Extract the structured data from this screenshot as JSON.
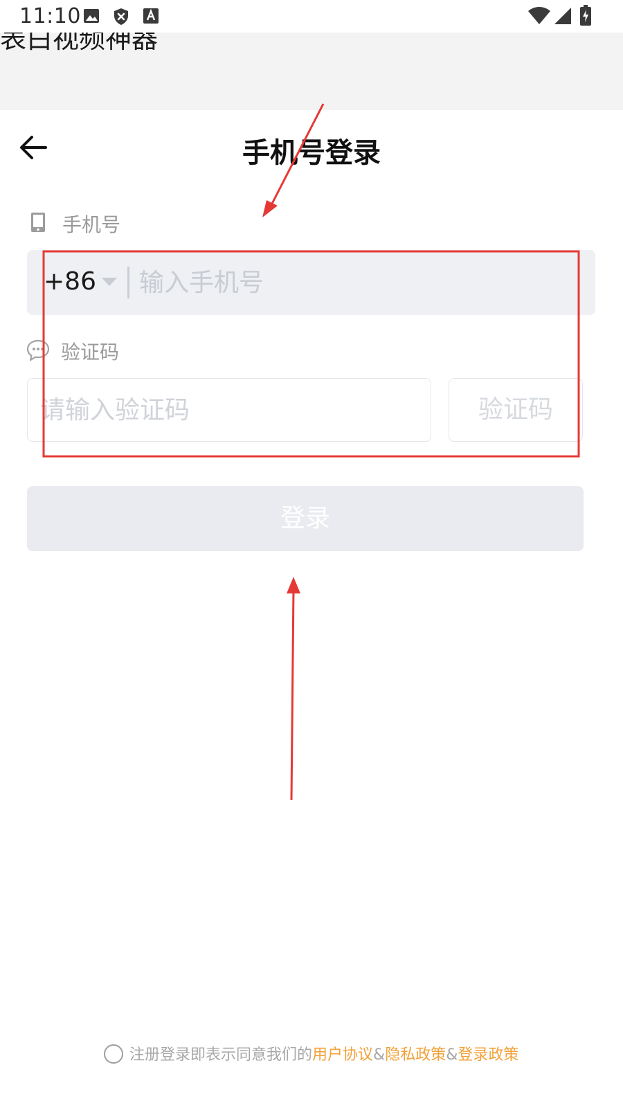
{
  "status_bar": {
    "time": "11:10",
    "left_icons": [
      "image-icon",
      "shield-x-icon",
      "font-a-icon"
    ],
    "right_icons": [
      "wifi-icon",
      "signal-icon",
      "battery-icon"
    ]
  },
  "app_banner": {
    "title": "表白视频神器"
  },
  "header": {
    "title": "手机号登录",
    "back_icon": "arrow-left-icon"
  },
  "phone_section": {
    "label": "手机号",
    "icon": "phone-icon",
    "country_code": "+86",
    "placeholder": "输入手机号",
    "value": ""
  },
  "code_section": {
    "label": "验证码",
    "icon": "chat-bubble-icon",
    "placeholder": "请输入验证码",
    "value": "",
    "get_code_label": "验证码"
  },
  "login_button": {
    "label": "登录"
  },
  "agreement": {
    "checked": false,
    "prefix": "注册登录即表示同意我们的",
    "link_user": "用户协议",
    "sep1": "&",
    "link_privacy": "隐私政策",
    "sep2": "&",
    "link_login": "登录政策"
  },
  "colors": {
    "accent_link": "#f2a23a",
    "annotation_red": "#e53935",
    "input_bg": "#eef0f3",
    "button_disabled_bg": "#e9ebf0"
  }
}
